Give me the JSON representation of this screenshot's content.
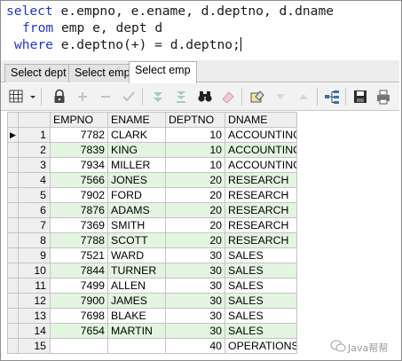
{
  "editor": {
    "line1_kw": "select",
    "line1_rest": " e.empno, e.ename, d.deptno, d.dname",
    "line2_kw": "from",
    "line2_rest": " emp e, dept d",
    "line3_kw": "where",
    "line3_rest": " e.deptno(+) = d.deptno;"
  },
  "tabs": [
    {
      "label": "Select dept"
    },
    {
      "label": "Select emp"
    },
    {
      "label": "Select emp"
    }
  ],
  "toolbar": {
    "icons": [
      "grid-icon",
      "lock-icon",
      "plus-icon",
      "minus-icon",
      "check-icon",
      "down-arrows-icon",
      "double-down-icon",
      "binoculars-icon",
      "eraser-icon",
      "query-icon",
      "filter-down-icon",
      "filter-up-icon",
      "tree-icon",
      "save-icon",
      "print-icon"
    ]
  },
  "grid": {
    "columns": [
      "EMPNO",
      "ENAME",
      "DEPTNO",
      "DNAME"
    ],
    "current_row_marker": "▶",
    "rows": [
      {
        "n": "1",
        "empno": "7782",
        "ename": "CLARK",
        "deptno": "10",
        "dname": "ACCOUNTING"
      },
      {
        "n": "2",
        "empno": "7839",
        "ename": "KING",
        "deptno": "10",
        "dname": "ACCOUNTING"
      },
      {
        "n": "3",
        "empno": "7934",
        "ename": "MILLER",
        "deptno": "10",
        "dname": "ACCOUNTING"
      },
      {
        "n": "4",
        "empno": "7566",
        "ename": "JONES",
        "deptno": "20",
        "dname": "RESEARCH"
      },
      {
        "n": "5",
        "empno": "7902",
        "ename": "FORD",
        "deptno": "20",
        "dname": "RESEARCH"
      },
      {
        "n": "6",
        "empno": "7876",
        "ename": "ADAMS",
        "deptno": "20",
        "dname": "RESEARCH"
      },
      {
        "n": "7",
        "empno": "7369",
        "ename": "SMITH",
        "deptno": "20",
        "dname": "RESEARCH"
      },
      {
        "n": "8",
        "empno": "7788",
        "ename": "SCOTT",
        "deptno": "20",
        "dname": "RESEARCH"
      },
      {
        "n": "9",
        "empno": "7521",
        "ename": "WARD",
        "deptno": "30",
        "dname": "SALES"
      },
      {
        "n": "10",
        "empno": "7844",
        "ename": "TURNER",
        "deptno": "30",
        "dname": "SALES"
      },
      {
        "n": "11",
        "empno": "7499",
        "ename": "ALLEN",
        "deptno": "30",
        "dname": "SALES"
      },
      {
        "n": "12",
        "empno": "7900",
        "ename": "JAMES",
        "deptno": "30",
        "dname": "SALES"
      },
      {
        "n": "13",
        "empno": "7698",
        "ename": "BLAKE",
        "deptno": "30",
        "dname": "SALES"
      },
      {
        "n": "14",
        "empno": "7654",
        "ename": "MARTIN",
        "deptno": "30",
        "dname": "SALES"
      },
      {
        "n": "15",
        "empno": "",
        "ename": "",
        "deptno": "40",
        "dname": "OPERATIONS"
      }
    ]
  },
  "watermark": {
    "text": "Java帮帮"
  },
  "colors": {
    "keyword": "#1e34d8",
    "alt_row": "#e3f5e0"
  }
}
